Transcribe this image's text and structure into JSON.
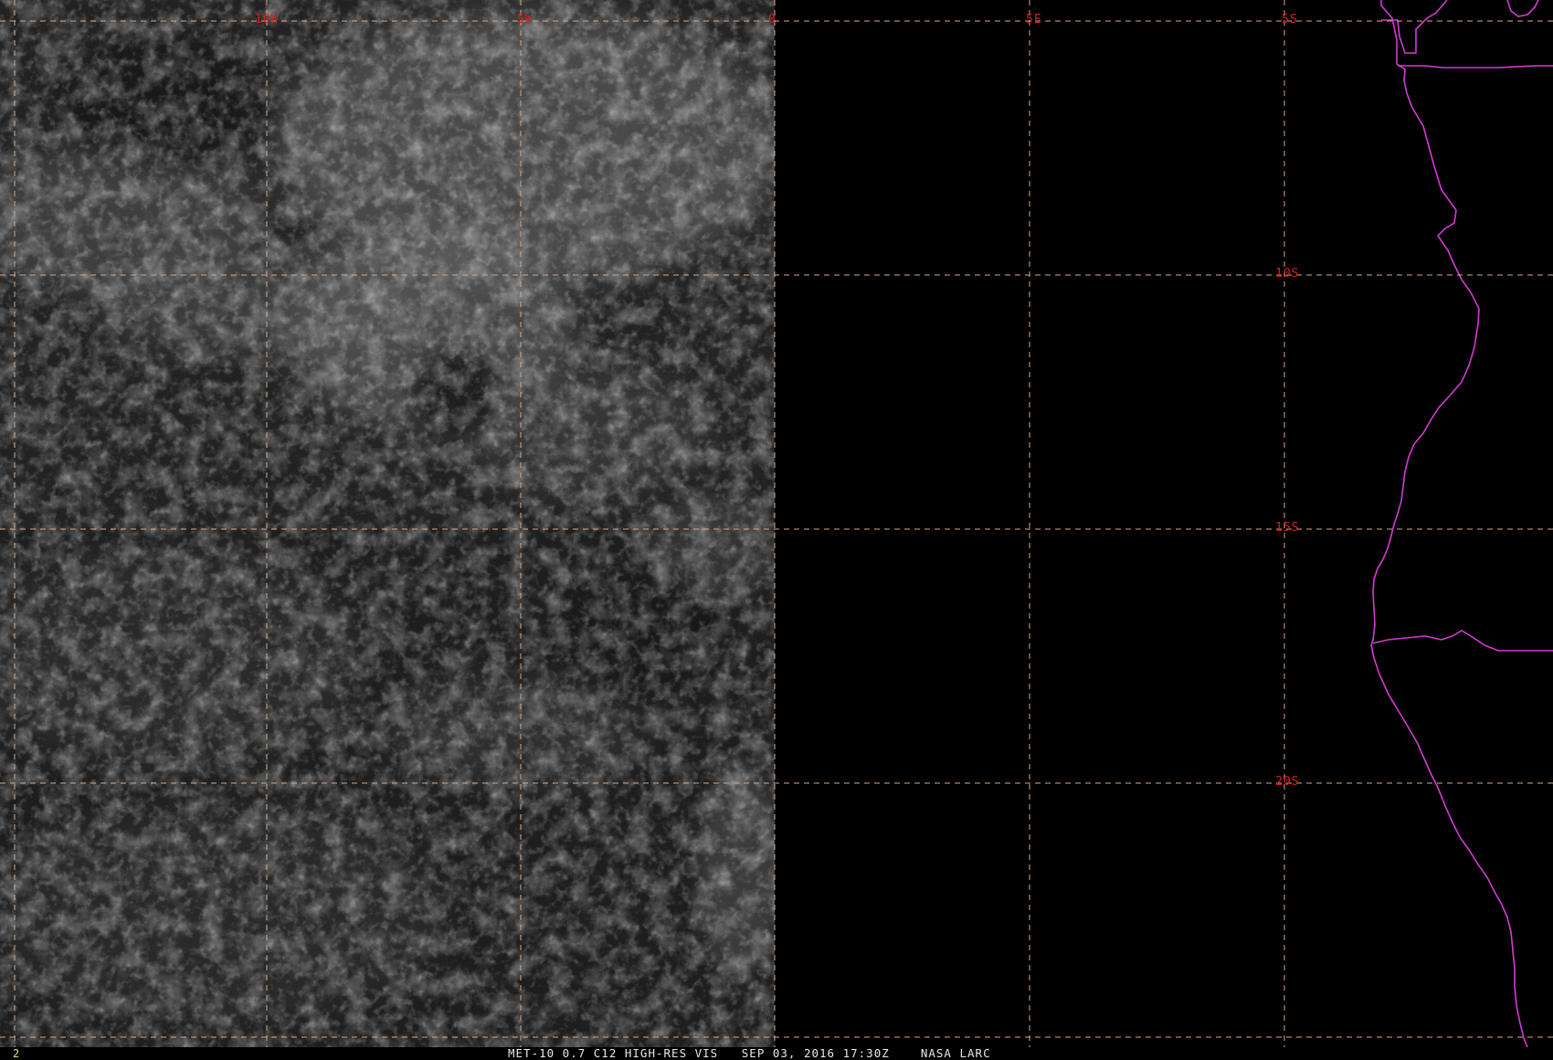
{
  "window": {
    "frame_number": "2",
    "caption": "MET-10 0.7 C12 HIGH-RES VIS   SEP 03, 2016 17:30Z    NASA LARC"
  },
  "map": {
    "longitude_labels": [
      "10W",
      "5W",
      "0",
      "5E"
    ],
    "latitude_labels": [
      "5S",
      "10S",
      "15S",
      "20S"
    ],
    "colors": {
      "background": "#000000",
      "grid": "#d9a884",
      "grid_label": "#d42020",
      "coastline": "#d43bd4",
      "caption": "#e8e8e8",
      "frame_number": "#e8e060"
    },
    "layers": [
      "visible-satellite-imagery",
      "coastline",
      "lat-lon-grid"
    ]
  }
}
